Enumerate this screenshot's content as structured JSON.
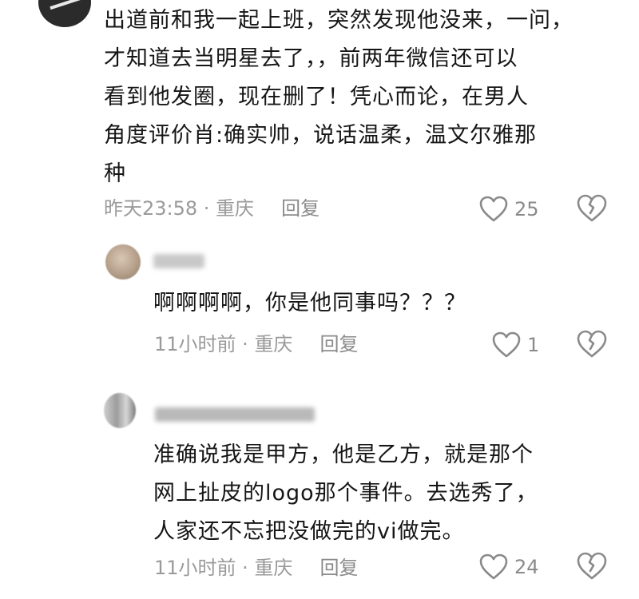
{
  "comment": {
    "text_lines": [
      "出道前和我一起上班，突然发现他没来，一问，",
      "才知道去当明星去了，，前两年微信还可以",
      "看到他发圈，现在删了！凭心而论，在男人",
      "角度评价肖:确实帅，说话温柔，温文尔雅那",
      "种"
    ],
    "time": "昨天23:58",
    "location": "重庆",
    "reply_label": "回复",
    "likes": "25"
  },
  "replies": [
    {
      "text_lines": [
        "啊啊啊啊，你是他同事吗？？？"
      ],
      "time": "11小时前",
      "location": "重庆",
      "reply_label": "回复",
      "likes": "1"
    },
    {
      "text_lines": [
        "准确说我是甲方，他是乙方，就是那个",
        "网上扯皮的logo那个事件。去选秀了，",
        "人家还不忘把没做完的vi做完。"
      ],
      "time": "11小时前",
      "location": "重庆",
      "reply_label": "回复",
      "likes": "24"
    }
  ],
  "separator": " · ",
  "icons": {
    "like": "heart-outline-icon",
    "dislike": "broken-heart-icon"
  },
  "colors": {
    "text": "#161616",
    "meta": "#9a9a9a",
    "icon": "#8a8a8a"
  }
}
